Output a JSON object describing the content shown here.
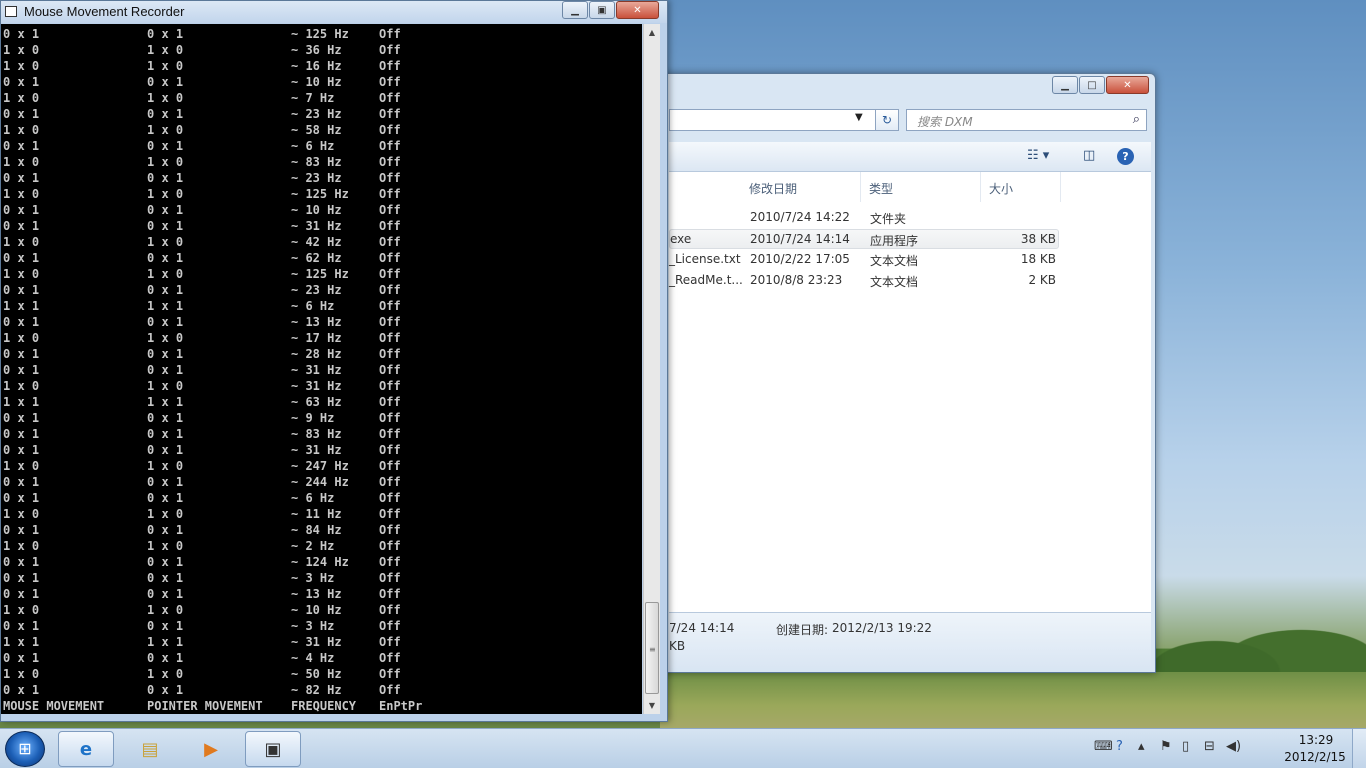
{
  "explorer": {
    "search_placeholder": "搜索 DXM",
    "columns": [
      "修改日期",
      "类型",
      "大小"
    ],
    "files": [
      {
        "name": "",
        "date": "2010/7/24 14:22",
        "type": "文件夹",
        "size": ""
      },
      {
        "name": "exe",
        "date": "2010/7/24 14:14",
        "type": "应用程序",
        "size": "38 KB"
      },
      {
        "name": "_License.txt",
        "date": "2010/2/22 17:05",
        "type": "文本文档",
        "size": "18 KB"
      },
      {
        "name": "_ReadMe.t...",
        "date": "2010/8/8 23:23",
        "type": "文本文档",
        "size": "2 KB"
      }
    ],
    "details_modified": "7/24 14:14",
    "details_created_label": "创建日期:",
    "details_created_value": "2012/2/13 19:22",
    "details_size": "KB"
  },
  "console": {
    "title": "Mouse Movement Recorder",
    "rows": [
      [
        "0 x 1",
        "0 x 1",
        "~ 125 Hz",
        "Off"
      ],
      [
        "1 x 0",
        "1 x 0",
        "~ 36 Hz",
        "Off"
      ],
      [
        "1 x 0",
        "1 x 0",
        "~ 16 Hz",
        "Off"
      ],
      [
        "0 x 1",
        "0 x 1",
        "~ 10 Hz",
        "Off"
      ],
      [
        "1 x 0",
        "1 x 0",
        "~ 7 Hz",
        "Off"
      ],
      [
        "0 x 1",
        "0 x 1",
        "~ 23 Hz",
        "Off"
      ],
      [
        "1 x 0",
        "1 x 0",
        "~ 58 Hz",
        "Off"
      ],
      [
        "0 x 1",
        "0 x 1",
        "~ 6 Hz",
        "Off"
      ],
      [
        "1 x 0",
        "1 x 0",
        "~ 83 Hz",
        "Off"
      ],
      [
        "0 x 1",
        "0 x 1",
        "~ 23 Hz",
        "Off"
      ],
      [
        "1 x 0",
        "1 x 0",
        "~ 125 Hz",
        "Off"
      ],
      [
        "0 x 1",
        "0 x 1",
        "~ 10 Hz",
        "Off"
      ],
      [
        "0 x 1",
        "0 x 1",
        "~ 31 Hz",
        "Off"
      ],
      [
        "1 x 0",
        "1 x 0",
        "~ 42 Hz",
        "Off"
      ],
      [
        "0 x 1",
        "0 x 1",
        "~ 62 Hz",
        "Off"
      ],
      [
        "1 x 0",
        "1 x 0",
        "~ 125 Hz",
        "Off"
      ],
      [
        "0 x 1",
        "0 x 1",
        "~ 23 Hz",
        "Off"
      ],
      [
        "1 x 1",
        "1 x 1",
        "~ 6 Hz",
        "Off"
      ],
      [
        "0 x 1",
        "0 x 1",
        "~ 13 Hz",
        "Off"
      ],
      [
        "1 x 0",
        "1 x 0",
        "~ 17 Hz",
        "Off"
      ],
      [
        "0 x 1",
        "0 x 1",
        "~ 28 Hz",
        "Off"
      ],
      [
        "0 x 1",
        "0 x 1",
        "~ 31 Hz",
        "Off"
      ],
      [
        "1 x 0",
        "1 x 0",
        "~ 31 Hz",
        "Off"
      ],
      [
        "1 x 1",
        "1 x 1",
        "~ 63 Hz",
        "Off"
      ],
      [
        "0 x 1",
        "0 x 1",
        "~ 9 Hz",
        "Off"
      ],
      [
        "0 x 1",
        "0 x 1",
        "~ 83 Hz",
        "Off"
      ],
      [
        "0 x 1",
        "0 x 1",
        "~ 31 Hz",
        "Off"
      ],
      [
        "1 x 0",
        "1 x 0",
        "~ 247 Hz",
        "Off"
      ],
      [
        "0 x 1",
        "0 x 1",
        "~ 244 Hz",
        "Off"
      ],
      [
        "0 x 1",
        "0 x 1",
        "~ 6 Hz",
        "Off"
      ],
      [
        "1 x 0",
        "1 x 0",
        "~ 11 Hz",
        "Off"
      ],
      [
        "0 x 1",
        "0 x 1",
        "~ 84 Hz",
        "Off"
      ],
      [
        "1 x 0",
        "1 x 0",
        "~ 2 Hz",
        "Off"
      ],
      [
        "0 x 1",
        "0 x 1",
        "~ 124 Hz",
        "Off"
      ],
      [
        "0 x 1",
        "0 x 1",
        "~ 3 Hz",
        "Off"
      ],
      [
        "0 x 1",
        "0 x 1",
        "~ 13 Hz",
        "Off"
      ],
      [
        "1 x 0",
        "1 x 0",
        "~ 10 Hz",
        "Off"
      ],
      [
        "0 x 1",
        "0 x 1",
        "~ 3 Hz",
        "Off"
      ],
      [
        "1 x 1",
        "1 x 1",
        "~ 31 Hz",
        "Off"
      ],
      [
        "0 x 1",
        "0 x 1",
        "~ 4 Hz",
        "Off"
      ],
      [
        "1 x 0",
        "1 x 0",
        "~ 50 Hz",
        "Off"
      ],
      [
        "0 x 1",
        "0 x 1",
        "~ 82 Hz",
        "Off"
      ],
      [
        "MOUSE MOVEMENT",
        "POINTER MOVEMENT",
        "FREQUENCY",
        "EnPtPr"
      ]
    ]
  },
  "taskbar": {
    "time": "13:29",
    "date": "2012/2/15"
  }
}
